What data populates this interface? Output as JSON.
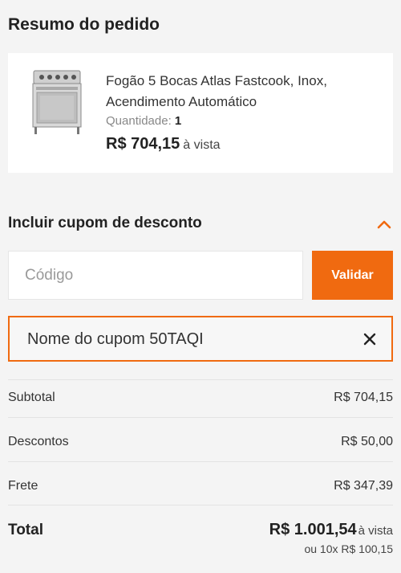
{
  "summary": {
    "title": "Resumo do pedido"
  },
  "product": {
    "name": "Fogão 5 Bocas Atlas Fastcook, Inox, Acendimento Automático",
    "quantity_label": "Quantidade:",
    "quantity": "1",
    "price": "R$ 704,15",
    "price_suffix": "à vista",
    "image_icon": "stove-image"
  },
  "coupon": {
    "title": "Incluir cupom de desconto",
    "toggle_icon": "chevron-up-icon",
    "input_placeholder": "Código",
    "input_value": "",
    "validate_label": "Validar",
    "applied_text": "Nome do cupom 50TAQI",
    "remove_icon": "close-icon"
  },
  "totals": {
    "subtotal_label": "Subtotal",
    "subtotal_value": "R$ 704,15",
    "discount_label": "Descontos",
    "discount_value": "R$ 50,00",
    "shipping_label": "Frete",
    "shipping_value": "R$ 347,39",
    "total_label": "Total",
    "total_value": "R$ 1.001,54",
    "total_suffix": "à vista",
    "installments": "ou 10x R$ 100,15"
  },
  "colors": {
    "accent": "#f06a10",
    "background": "#f4f4f4",
    "card": "#ffffff"
  }
}
